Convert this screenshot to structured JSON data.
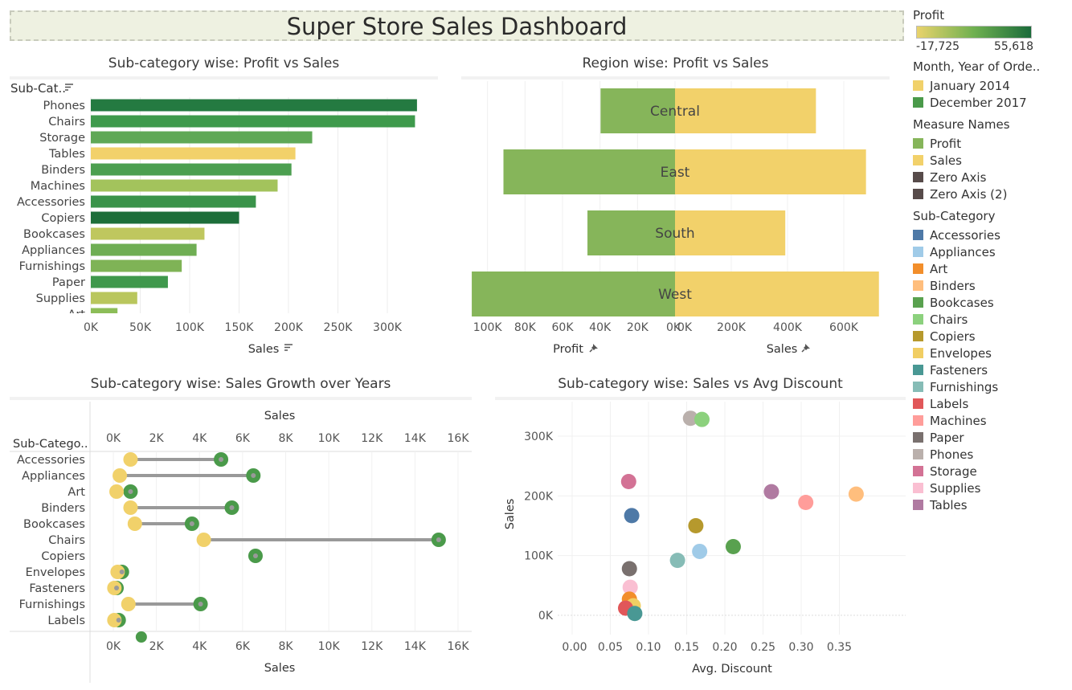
{
  "title": "Super Store Sales Dashboard",
  "panels": {
    "p1_title": "Sub-category wise: Profit vs Sales",
    "p2_title": "Region wise: Profit vs Sales",
    "p3_title": "Sub-category wise: Sales Growth over Years",
    "p4_title": "Sub-category wise: Sales vs Avg Discount"
  },
  "legend": {
    "profit_title": "Profit",
    "profit_min": "-17,725",
    "profit_max": "55,618",
    "gradient": [
      "#e9d36c",
      "#6fb050",
      "#1a6b3a"
    ],
    "month_title": "Month, Year of Orde..",
    "months": [
      {
        "label": "January 2014",
        "color": "#f1d16a"
      },
      {
        "label": "December 2017",
        "color": "#4a9a4a"
      }
    ],
    "measure_title": "Measure Names",
    "measures": [
      {
        "label": "Profit",
        "color": "#86b55a"
      },
      {
        "label": "Sales",
        "color": "#f2d16a"
      },
      {
        "label": "Zero Axis",
        "color": "#574b4a"
      },
      {
        "label": "Zero Axis (2)",
        "color": "#574b4a"
      }
    ],
    "subcat_title": "Sub-Category",
    "subcats": [
      {
        "label": "Accessories",
        "color": "#4e79a7"
      },
      {
        "label": "Appliances",
        "color": "#a0cbe8"
      },
      {
        "label": "Art",
        "color": "#f28e2b"
      },
      {
        "label": "Binders",
        "color": "#ffbe7d"
      },
      {
        "label": "Bookcases",
        "color": "#59a14f"
      },
      {
        "label": "Chairs",
        "color": "#8cd17d"
      },
      {
        "label": "Copiers",
        "color": "#b6992d"
      },
      {
        "label": "Envelopes",
        "color": "#f1ce63"
      },
      {
        "label": "Fasteners",
        "color": "#499894"
      },
      {
        "label": "Furnishings",
        "color": "#86bcb6"
      },
      {
        "label": "Labels",
        "color": "#e15759"
      },
      {
        "label": "Machines",
        "color": "#ff9d9a"
      },
      {
        "label": "Paper",
        "color": "#79706e"
      },
      {
        "label": "Phones",
        "color": "#bab0ac"
      },
      {
        "label": "Storage",
        "color": "#d37295"
      },
      {
        "label": "Supplies",
        "color": "#fabfd2"
      },
      {
        "label": "Tables",
        "color": "#b07aa1"
      }
    ]
  },
  "chart_data": [
    {
      "type": "bar",
      "title": "Sub-category wise: Profit vs Sales",
      "row_header": "Sub-Cat..",
      "xlabel": "Sales",
      "xlim": [
        0,
        350000
      ],
      "xticks": [
        0,
        50000,
        100000,
        150000,
        200000,
        250000,
        300000
      ],
      "xtick_labels": [
        "0K",
        "50K",
        "100K",
        "150K",
        "200K",
        "250K",
        "300K"
      ],
      "categories": [
        "Phones",
        "Chairs",
        "Storage",
        "Tables",
        "Binders",
        "Machines",
        "Accessories",
        "Copiers",
        "Bookcases",
        "Appliances",
        "Furnishings",
        "Paper",
        "Supplies",
        "Art"
      ],
      "values": [
        330000,
        328000,
        224000,
        207000,
        203000,
        189000,
        167000,
        150000,
        115000,
        107000,
        92000,
        78000,
        47000,
        27000
      ],
      "colors": [
        "#247a41",
        "#3e9a4c",
        "#5fa856",
        "#f2d16a",
        "#4c9f50",
        "#a3c35c",
        "#3a934a",
        "#1d6e3a",
        "#bfc75e",
        "#6fae53",
        "#7fb356",
        "#3f984c",
        "#b9c65d",
        "#8cbd58"
      ]
    },
    {
      "type": "bar",
      "title": "Region wise: Profit vs Sales",
      "categories": [
        "Central",
        "East",
        "South",
        "West"
      ],
      "series": [
        {
          "name": "Profit",
          "values": [
            39700,
            91500,
            46700,
            108400
          ],
          "xlim": [
            0,
            110000
          ],
          "xticks": [
            100000,
            80000,
            60000,
            40000,
            20000,
            0
          ],
          "xtick_labels": [
            "100K",
            "80K",
            "60K",
            "40K",
            "20K",
            "0K"
          ],
          "xlabel": "Profit"
        },
        {
          "name": "Sales",
          "values": [
            501000,
            679000,
            392000,
            725000
          ],
          "xlim": [
            0,
            730000
          ],
          "xticks": [
            0,
            200000,
            400000,
            600000
          ],
          "xtick_labels": [
            "0K",
            "200K",
            "400K",
            "600K"
          ],
          "xlabel": "Sales"
        }
      ]
    },
    {
      "type": "dumbbell",
      "title": "Sub-category wise: Sales Growth over Years",
      "row_header": "Sub-Catego..",
      "xlabel": "Sales",
      "xlim": [
        0,
        16000
      ],
      "xticks": [
        0,
        2000,
        4000,
        6000,
        8000,
        10000,
        12000,
        14000,
        16000
      ],
      "xtick_labels": [
        "0K",
        "2K",
        "4K",
        "6K",
        "8K",
        "10K",
        "12K",
        "14K",
        "16K"
      ],
      "categories": [
        "Accessories",
        "Appliances",
        "Art",
        "Binders",
        "Bookcases",
        "Chairs",
        "Copiers",
        "Envelopes",
        "Fasteners",
        "Furnishings",
        "Labels"
      ],
      "series": [
        {
          "name": "January 2014",
          "values": [
            800,
            300,
            150,
            800,
            1000,
            4200,
            null,
            200,
            50,
            700,
            50
          ]
        },
        {
          "name": "December 2017",
          "values": [
            5000,
            6500,
            800,
            5500,
            3650,
            15100,
            6600,
            400,
            150,
            4050,
            250
          ]
        }
      ]
    },
    {
      "type": "scatter",
      "title": "Sub-category wise: Sales vs Avg Discount",
      "xlabel": "Avg. Discount",
      "ylabel": "Sales",
      "xlim": [
        0,
        0.38
      ],
      "ylim": [
        -20000,
        340000
      ],
      "xticks": [
        0,
        0.05,
        0.1,
        0.15,
        0.2,
        0.25,
        0.3,
        0.35
      ],
      "xtick_labels": [
        "0.00",
        "0.05",
        "0.10",
        "0.15",
        "0.20",
        "0.25",
        "0.30",
        "0.35"
      ],
      "yticks": [
        0,
        100000,
        200000,
        300000
      ],
      "ytick_labels": [
        "0K",
        "100K",
        "200K",
        "300K"
      ],
      "points": [
        {
          "name": "Phones",
          "x": 0.155,
          "y": 330000
        },
        {
          "name": "Chairs",
          "x": 0.17,
          "y": 328000
        },
        {
          "name": "Storage",
          "x": 0.074,
          "y": 224000
        },
        {
          "name": "Tables",
          "x": 0.261,
          "y": 207000
        },
        {
          "name": "Binders",
          "x": 0.372,
          "y": 203000
        },
        {
          "name": "Machines",
          "x": 0.306,
          "y": 189000
        },
        {
          "name": "Accessories",
          "x": 0.078,
          "y": 167000
        },
        {
          "name": "Copiers",
          "x": 0.162,
          "y": 150000
        },
        {
          "name": "Bookcases",
          "x": 0.211,
          "y": 115000
        },
        {
          "name": "Appliances",
          "x": 0.167,
          "y": 107000
        },
        {
          "name": "Furnishings",
          "x": 0.138,
          "y": 92000
        },
        {
          "name": "Paper",
          "x": 0.075,
          "y": 78000
        },
        {
          "name": "Supplies",
          "x": 0.076,
          "y": 47000
        },
        {
          "name": "Art",
          "x": 0.075,
          "y": 27000
        },
        {
          "name": "Envelopes",
          "x": 0.08,
          "y": 16000
        },
        {
          "name": "Labels",
          "x": 0.07,
          "y": 12000
        },
        {
          "name": "Fasteners",
          "x": 0.082,
          "y": 3000
        }
      ]
    }
  ]
}
